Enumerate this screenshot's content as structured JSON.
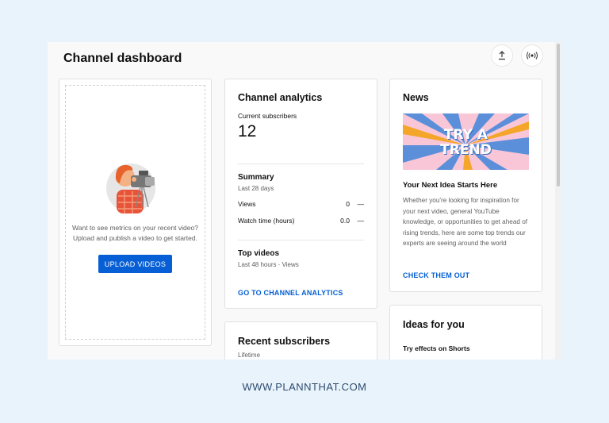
{
  "header": {
    "title": "Channel dashboard",
    "upload_icon": "upload-icon",
    "live_icon": "live-broadcast-icon"
  },
  "upload_card": {
    "message": "Want to see metrics on your recent video? Upload and publish a video to get started.",
    "button_label": "UPLOAD VIDEOS"
  },
  "analytics": {
    "title": "Channel analytics",
    "subscribers_label": "Current subscribers",
    "subscribers_value": "12",
    "summary_title": "Summary",
    "summary_period": "Last 28 days",
    "metrics": [
      {
        "label": "Views",
        "value": "0",
        "trend": "—"
      },
      {
        "label": "Watch time (hours)",
        "value": "0.0",
        "trend": "—"
      }
    ],
    "top_videos_title": "Top videos",
    "top_videos_period": "Last 48 hours · Views",
    "link_label": "GO TO CHANNEL ANALYTICS"
  },
  "news": {
    "title": "News",
    "image_text_line1": "TRY A",
    "image_text_line2": "TREND",
    "headline": "Your Next Idea Starts Here",
    "body": "Whether you're looking for inspiration for your next video, general YouTube knowledge, or opportunities to get ahead of rising trends, here are some top trends our experts are seeing around the world",
    "link_label": "CHECK THEM OUT"
  },
  "recent_subscribers": {
    "title": "Recent subscribers",
    "period": "Lifetime"
  },
  "ideas": {
    "title": "Ideas for you",
    "item": "Try effects on Shorts"
  },
  "footer": {
    "text": "WWW.PLANNTHAT.COM"
  },
  "colors": {
    "accent": "#065fd4",
    "page_bg": "#e9f3fc",
    "news_banner_bg": "#f9c6d8",
    "news_banner_text": "#ffffff"
  }
}
